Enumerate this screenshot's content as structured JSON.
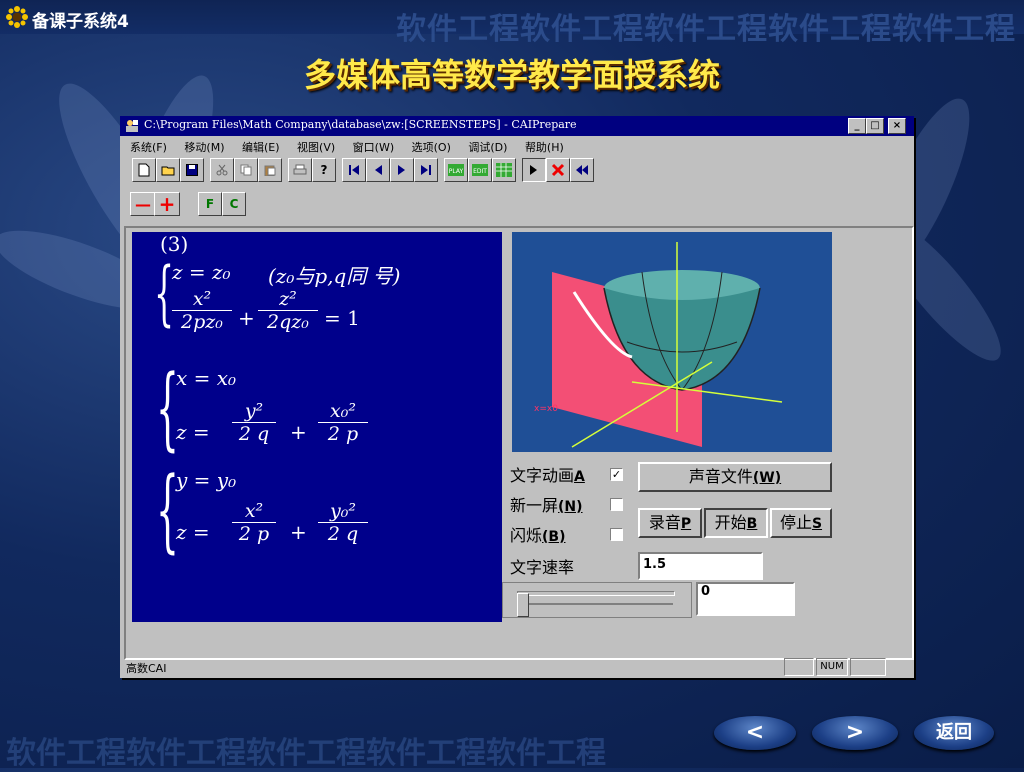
{
  "app_title": "备课子系统4",
  "slide_title": "多媒体高等数学教学面授系统",
  "watermark_text": "软件工程软件工程软件工程软件工程软件工程",
  "window": {
    "title": "C:\\Program Files\\Math Company\\database\\zw:[SCREENSTEPS] - CAIPrepare",
    "menu": [
      "系统(F)",
      "移动(M)",
      "编辑(E)",
      "视图(V)",
      "窗口(W)",
      "选项(O)",
      "调试(D)",
      "帮助(H)"
    ],
    "status_text": "高数CAI",
    "status_num": "NUM"
  },
  "toolbar2": {
    "minus": "—",
    "plus": "+",
    "f": "F",
    "c": "C"
  },
  "formula": {
    "label": "(3)",
    "l1": "z = z₀",
    "l1b": "(z₀与p,q同 号)",
    "eq1": "= 1",
    "b2l1": "x  =  x₀",
    "b3l1": "y  =  y₀"
  },
  "graph": {
    "plane_label": "x=x0"
  },
  "controls": {
    "text_anim_label": "文字动画",
    "text_anim_key": "A",
    "new_screen_label": "新一屏",
    "new_screen_key": "(N)",
    "blink_label": "闪烁",
    "blink_key": "(B)",
    "speed_label": "文字速率",
    "speed_value": "1.5",
    "slider_value": "0",
    "sound_file_btn": "声音文件",
    "sound_file_key": "(W)",
    "record_btn": "录音",
    "record_key": "P",
    "start_btn": "开始",
    "start_key": "B",
    "stop_btn": "停止",
    "stop_key": "S",
    "text_anim_checked": true
  },
  "nav": {
    "prev": "<",
    "next": ">",
    "back": "返回"
  }
}
